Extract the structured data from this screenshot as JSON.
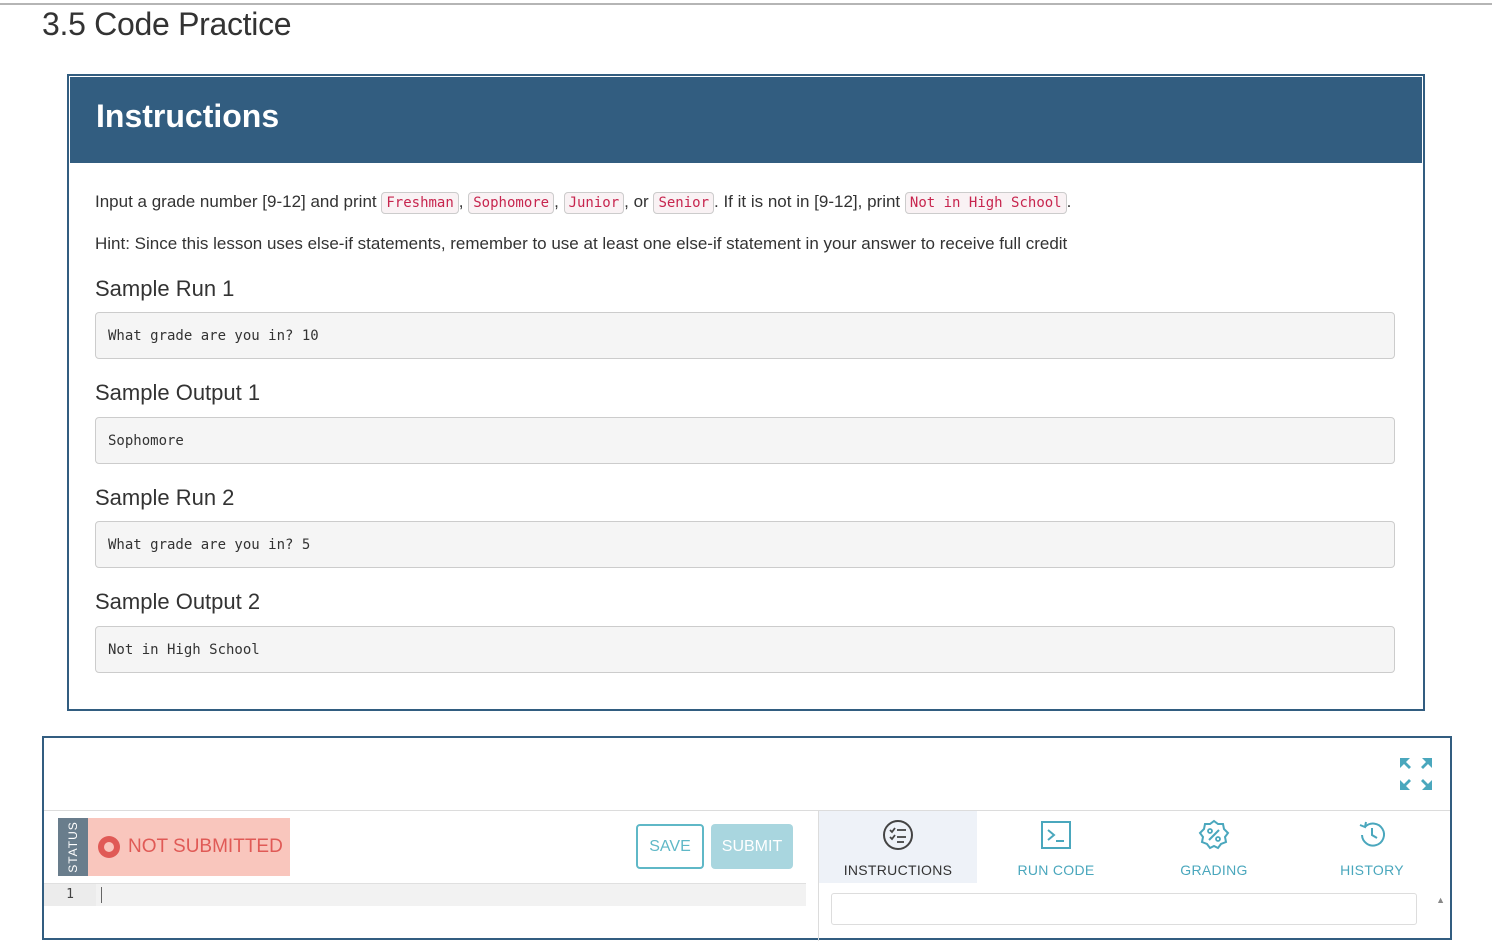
{
  "page": {
    "title": "3.5 Code Practice"
  },
  "instructions": {
    "header": "Instructions",
    "line1": {
      "t1": "Input a grade number [9-12] and print ",
      "c1": "Freshman",
      "t2": ", ",
      "c2": "Sophomore",
      "t3": ", ",
      "c3": "Junior",
      "t4": ", or ",
      "c4": "Senior",
      "t5": ". If it is not in [9-12], print ",
      "c5": "Not in High School",
      "t6": "."
    },
    "hint": "Hint: Since this lesson uses else-if statements, remember to use at least one else-if statement in your answer to receive full credit",
    "sections": [
      {
        "heading": "Sample Run 1",
        "code": "What grade are you in? 10"
      },
      {
        "heading": "Sample Output 1",
        "code": "Sophomore"
      },
      {
        "heading": "Sample Run 2",
        "code": "What grade are you in? 5"
      },
      {
        "heading": "Sample Output 2",
        "code": "Not in High School"
      }
    ]
  },
  "ide": {
    "status_label": "STATUS",
    "status_text": "NOT SUBMITTED",
    "save_label": "SAVE",
    "submit_label": "SUBMIT",
    "line_number": "1",
    "tabs": [
      {
        "label": "INSTRUCTIONS",
        "icon": "instructions-icon",
        "active": true
      },
      {
        "label": "RUN CODE",
        "icon": "terminal-icon",
        "active": false
      },
      {
        "label": "GRADING",
        "icon": "grading-badge-icon",
        "active": false
      },
      {
        "label": "HISTORY",
        "icon": "history-icon",
        "active": false
      }
    ],
    "fullscreen_icon": "expand-icon"
  },
  "colors": {
    "header_blue": "#325d80",
    "accent_teal": "#4aa7bd",
    "status_red": "#e05a56",
    "status_bg": "#f9c6bd",
    "inline_code": "#c7254e"
  }
}
